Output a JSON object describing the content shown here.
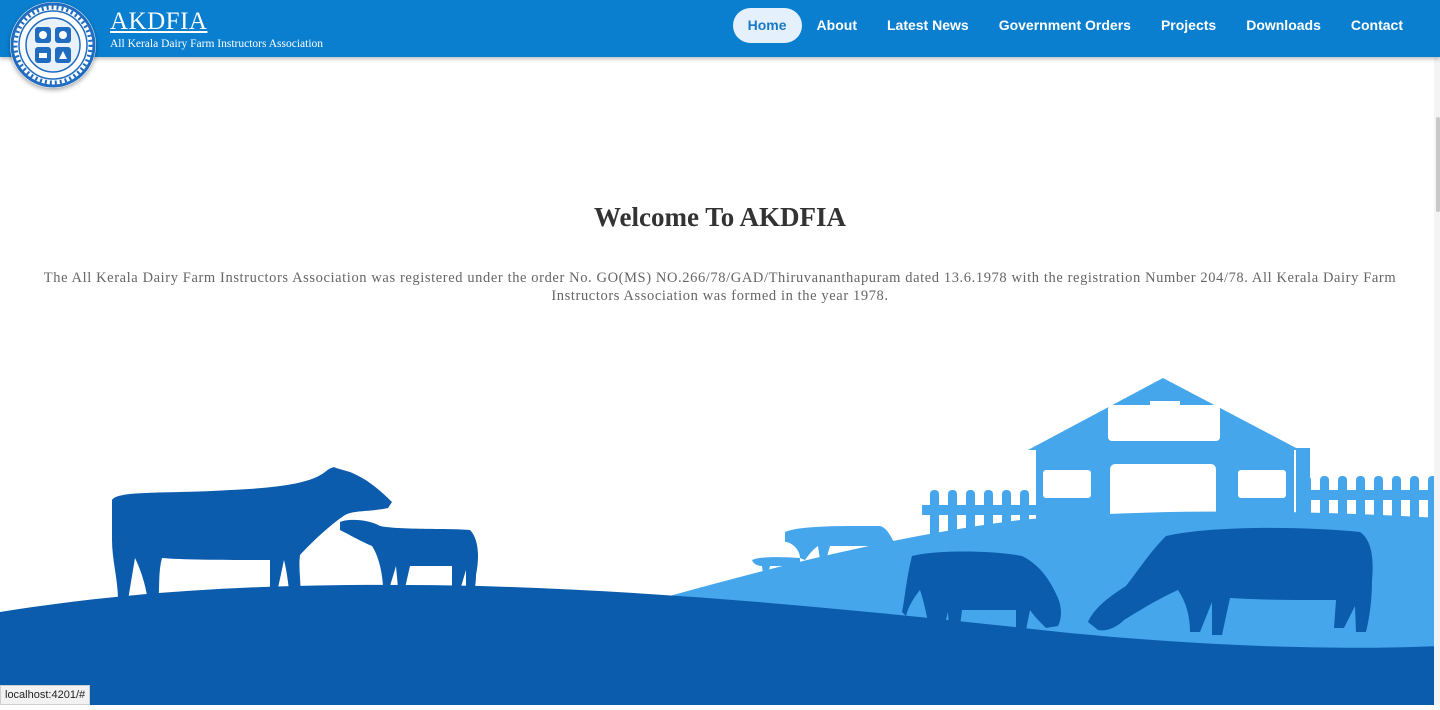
{
  "brand": {
    "name": "AKDFIA",
    "subtitle": "All Kerala Dairy Farm Instructors Association"
  },
  "nav": {
    "items": [
      {
        "label": "Home",
        "active": true
      },
      {
        "label": "About",
        "active": false
      },
      {
        "label": "Latest News",
        "active": false
      },
      {
        "label": "Government Orders",
        "active": false
      },
      {
        "label": "Projects",
        "active": false
      },
      {
        "label": "Downloads",
        "active": false
      },
      {
        "label": "Contact",
        "active": false
      }
    ]
  },
  "main": {
    "title": "Welcome To AKDFIA",
    "intro": "The All Kerala Dairy Farm Instructors Association was registered under the order No. GO(MS) NO.266/78/GAD/Thiruvananthapuram dated 13.6.1978 with the registration Number 204/78. All Kerala Dairy Farm Instructors Association was formed in the year 1978."
  },
  "status_bar": {
    "url": "localhost:4201/#"
  },
  "colors": {
    "navbar": "#0a7fd0",
    "active_pill": "#e4f0fb",
    "dark_blue": "#0b5cad",
    "light_blue": "#3fa4ea"
  },
  "icons": {
    "logo": "association-seal-icon"
  }
}
